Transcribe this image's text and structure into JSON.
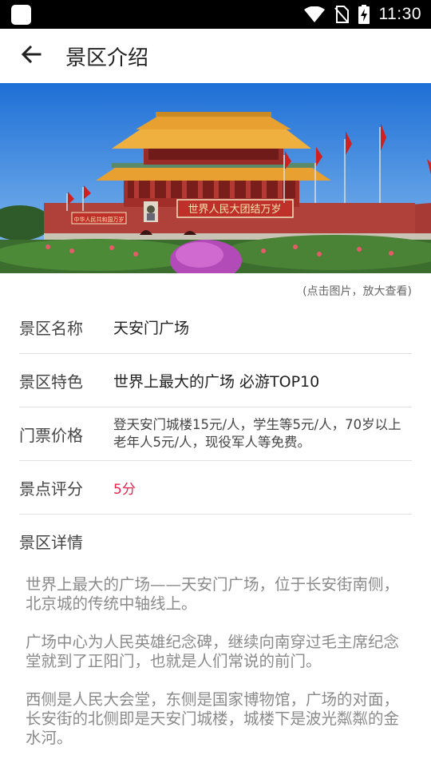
{
  "status_bar": {
    "time": "11:30",
    "icons": [
      "wifi-icon",
      "no-sim-icon",
      "battery-charging-icon"
    ]
  },
  "app_bar": {
    "back_icon": "arrow-left-icon",
    "title": "景区介绍"
  },
  "hero": {
    "image": "tiananmen-gate-photo",
    "banner_main": "世界人民大团结万岁",
    "banner_left": "中华人民共和国万岁"
  },
  "hint": "(点击图片，放大查看)",
  "info": {
    "name_label": "景区名称",
    "name_value": "天安门广场",
    "feature_label": "景区特色",
    "feature_value": "世界上最大的广场 必游TOP10",
    "ticket_label": "门票价格",
    "ticket_value": "登天安门城楼15元/人，学生等5元/人，70岁以上老年人5元/人，现役军人等免费。",
    "rating_label": "景点评分",
    "rating_value": "5分",
    "rating_color": "#e8224a"
  },
  "details": {
    "title": "景区详情",
    "paragraphs": [
      "世界上最大的广场——天安门广场，位于长安街南侧，北京城的传统中轴线上。",
      "广场中心为人民英雄纪念碑，继续向南穿过毛主席纪念堂就到了正阳门，也就是人们常说的前门。",
      "西侧是人民大会堂，东侧是国家博物馆，广场的对面，长安街的北侧即是天安门城楼，城楼下是波光粼粼的金水河。"
    ]
  }
}
